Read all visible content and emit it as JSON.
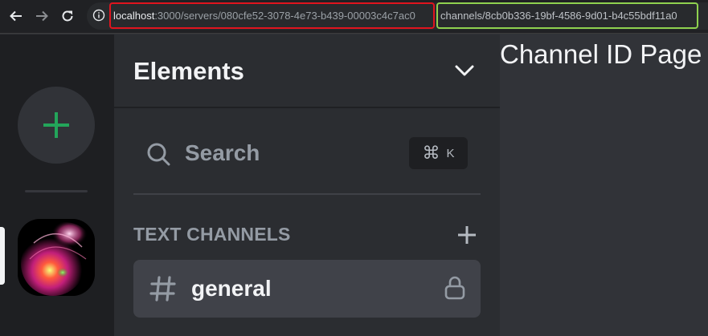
{
  "browser": {
    "url_host": "localhost",
    "url_server_part": ":3000/servers/080cfe52-3078-4e73-b439-00003c4c7ac0",
    "url_channel_part": "channels/8cb0b336-19bf-4586-9d01-b4c55bdf11a0",
    "highlight_colors": {
      "server": "#e0141e",
      "channel": "#8fd14f"
    }
  },
  "server": {
    "name": "Elements"
  },
  "search": {
    "label": "Search",
    "shortcut_symbol": "⌘",
    "shortcut_key": "K"
  },
  "categories": [
    {
      "label": "TEXT CHANNELS",
      "channels": [
        {
          "name": "general",
          "icon": "hash-icon",
          "locked": true,
          "active": true
        }
      ]
    }
  ],
  "main": {
    "label": "Channel ID Page"
  },
  "colors": {
    "accent_green": "#23a55a",
    "rail_bg": "#1e1f22",
    "sidebar_bg": "#2b2d31",
    "main_bg": "#313338"
  }
}
